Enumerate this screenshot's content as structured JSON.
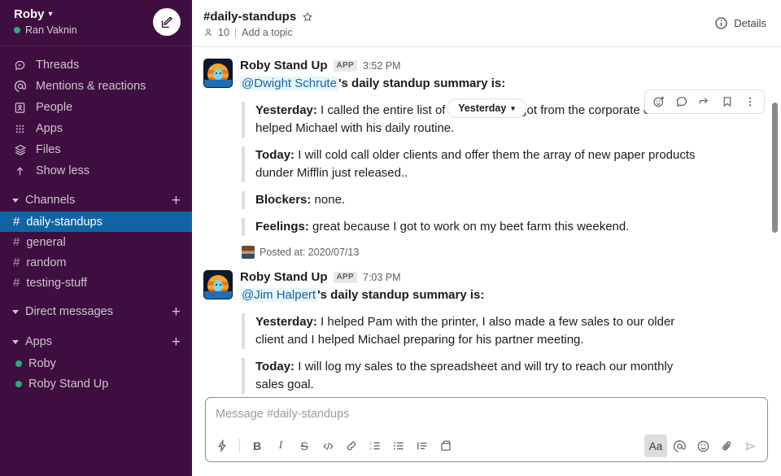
{
  "sidebar": {
    "team_name": "Roby",
    "user_name": "Ran Vaknin",
    "compose_icon": "compose-pencil-icon",
    "nav": [
      {
        "label": "Threads",
        "icon": "threads-icon"
      },
      {
        "label": "Mentions & reactions",
        "icon": "at-sign-icon"
      },
      {
        "label": "People",
        "icon": "person-card-icon"
      },
      {
        "label": "Apps",
        "icon": "grid-dots-icon"
      },
      {
        "label": "Files",
        "icon": "layers-icon"
      },
      {
        "label": "Show less",
        "icon": "arrow-up-icon"
      }
    ],
    "channels_section": {
      "label": "Channels",
      "add_label": "+"
    },
    "channels": [
      {
        "name": "daily-standups",
        "active": true
      },
      {
        "name": "general",
        "active": false
      },
      {
        "name": "random",
        "active": false
      },
      {
        "name": "testing-stuff",
        "active": false
      }
    ],
    "dms_section": {
      "label": "Direct messages",
      "add_label": "+"
    },
    "apps_section": {
      "label": "Apps",
      "add_label": "+"
    },
    "apps": [
      {
        "name": "Roby"
      },
      {
        "name": "Roby Stand Up"
      }
    ]
  },
  "header": {
    "channel": "#daily-standups",
    "star_icon": "star-outline-icon",
    "member_icon": "person-icon",
    "member_count": "10",
    "divider": "|",
    "topic_placeholder": "Add a topic",
    "details_label": "Details",
    "details_icon": "info-circle-icon"
  },
  "date_divider": {
    "label": "Yesterday",
    "caret": "chevron-down-icon"
  },
  "hover_actions": [
    {
      "name": "add-reaction-icon"
    },
    {
      "name": "reply-in-thread-icon"
    },
    {
      "name": "share-message-icon"
    },
    {
      "name": "save-bookmark-icon"
    },
    {
      "name": "more-actions-icon"
    }
  ],
  "messages": [
    {
      "author": "Roby Stand Up",
      "badge": "APP",
      "time": "3:52 PM",
      "mention": "@Dwight Schrute",
      "intro_suffix": "'s daily standup summary is:",
      "quotes": [
        {
          "label": "Yesterday:",
          "text": " I called the entire list of sales leads I got from the corporate office and helped Michael with his daily routine."
        },
        {
          "label": "Today:",
          "text": " I will cold call older clients and offer them the array of new paper products dunder Mifflin just released.."
        },
        {
          "label": "Blockers:",
          "text": " none."
        },
        {
          "label": "Feelings:",
          "text": " great because I got to work on my beet farm this weekend."
        }
      ],
      "posted_at": "Posted at: 2020/07/13"
    },
    {
      "author": "Roby Stand Up",
      "badge": "APP",
      "time": "7:03 PM",
      "mention": "@Jim Halpert",
      "intro_suffix": "'s daily standup summary is:",
      "quotes": [
        {
          "label": "Yesterday:",
          "text": " I helped Pam with the printer, I also made a few sales to our older client and I helped Michael preparing for his partner meeting."
        },
        {
          "label": "Today:",
          "text": " I will log my sales to the spreadsheet and will try to reach our monthly sales goal."
        }
      ],
      "posted_at": ""
    }
  ],
  "composer": {
    "placeholder": "Message #daily-standups",
    "left_tools": [
      {
        "name": "shortcuts-lightning-icon"
      },
      {
        "name": "bold-icon",
        "text": "B"
      },
      {
        "name": "italic-icon",
        "text": "I"
      },
      {
        "name": "strikethrough-icon",
        "text": "S"
      },
      {
        "name": "code-icon"
      },
      {
        "name": "link-icon"
      },
      {
        "name": "ordered-list-icon"
      },
      {
        "name": "bulleted-list-icon"
      },
      {
        "name": "blockquote-icon"
      },
      {
        "name": "code-block-icon"
      }
    ],
    "right_tools": [
      {
        "name": "formatting-aa-button",
        "text": "Aa",
        "active": true
      },
      {
        "name": "mention-at-icon"
      },
      {
        "name": "emoji-icon"
      },
      {
        "name": "attachment-icon"
      },
      {
        "name": "send-icon"
      }
    ]
  },
  "colors": {
    "sidebar_bg": "#3F0E40",
    "active_channel": "#1164A3",
    "presence_green": "#2BAC76",
    "mention_blue": "#1264A3",
    "text_primary": "#1D1C1D"
  }
}
